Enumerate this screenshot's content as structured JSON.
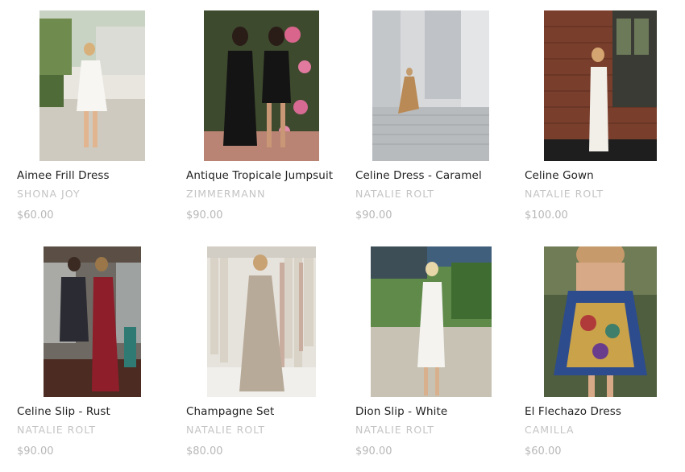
{
  "products": [
    {
      "title": "Aimee Frill Dress",
      "brand": "SHONA JOY",
      "price": "$60.00",
      "image": "woman-white-frill-dress-photo"
    },
    {
      "title": "Antique Tropicale Jumpsuit",
      "brand": "ZIMMERMANN",
      "price": "$90.00",
      "image": "two-women-black-dresses-photo"
    },
    {
      "title": "Celine Dress - Caramel",
      "brand": "NATALIE ROLT",
      "price": "$90.00",
      "image": "woman-caramel-dress-stairs-photo"
    },
    {
      "title": "Celine Gown",
      "brand": "NATALIE ROLT",
      "price": "$100.00",
      "image": "woman-white-gown-brick-wall-photo"
    },
    {
      "title": "Celine Slip - Rust",
      "brand": "NATALIE ROLT",
      "price": "$90.00",
      "image": "two-women-rust-slip-photo"
    },
    {
      "title": "Champagne Set",
      "brand": "NATALIE ROLT",
      "price": "$80.00",
      "image": "woman-champagne-set-rack-photo"
    },
    {
      "title": "Dion Slip - White",
      "brand": "NATALIE ROLT",
      "price": "$90.00",
      "image": "woman-white-slip-garden-photo"
    },
    {
      "title": "El Flechazo Dress",
      "brand": "CAMILLA",
      "price": "$60.00",
      "image": "woman-printed-dress-photo"
    }
  ]
}
